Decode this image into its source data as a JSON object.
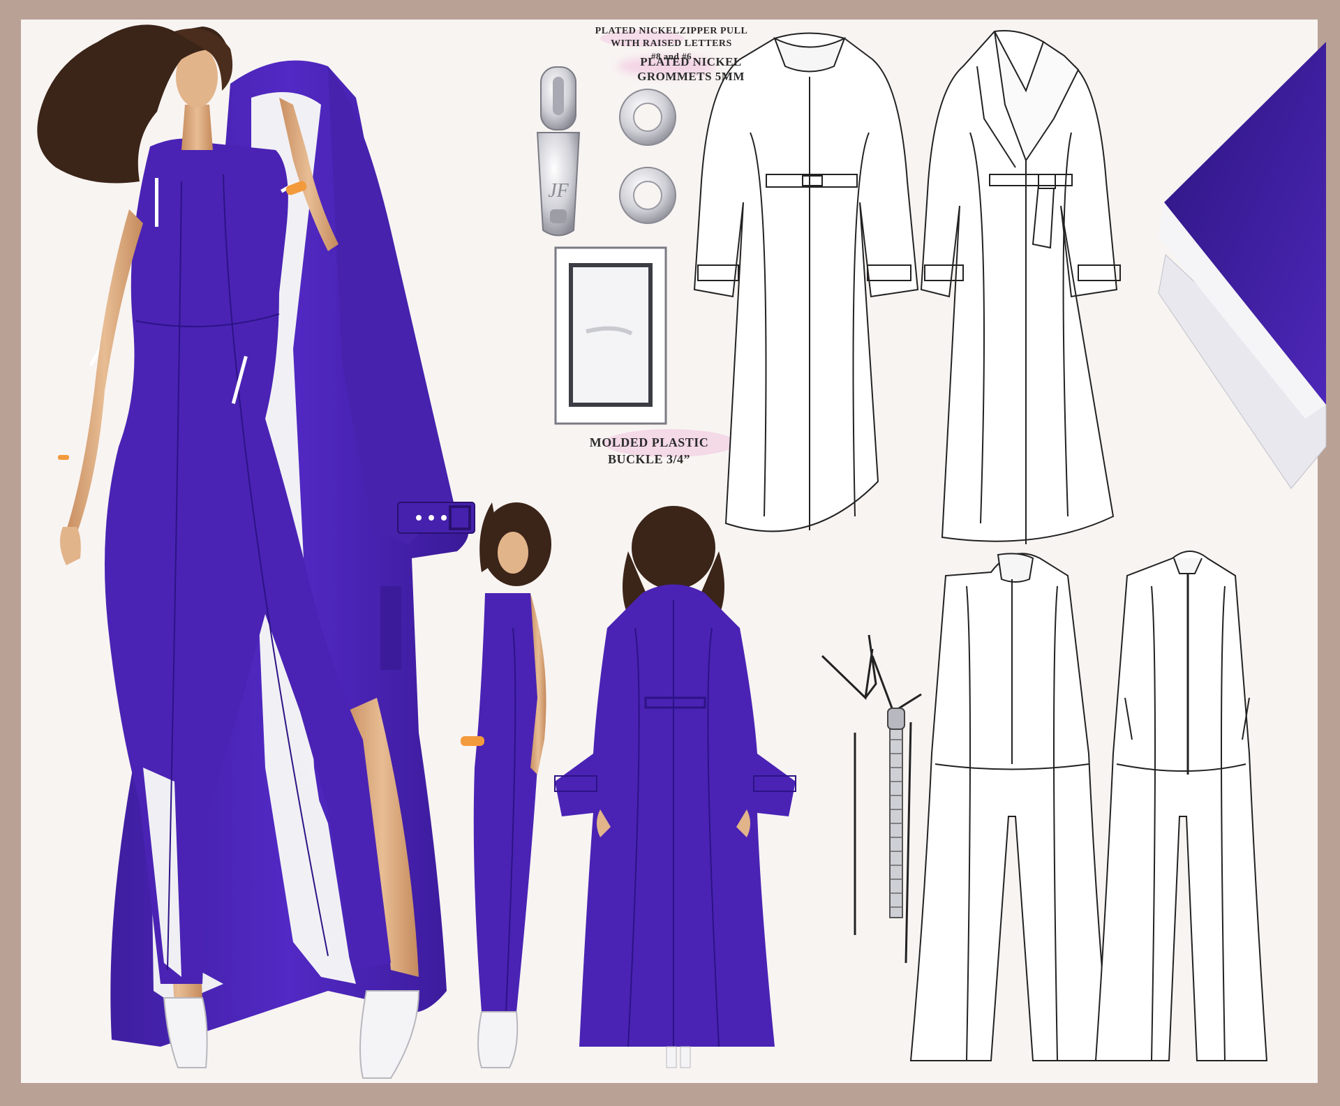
{
  "labels": {
    "zipper_pull": [
      "PLATED NICKELZIPPER PULL",
      "WITH RAISED LETTERS",
      "#8 and #6"
    ],
    "grommets": [
      "PLATED NICKEL",
      "GROMMETS 5MM"
    ],
    "buckle": [
      "MOLDED PLASTIC",
      "BUCKLE 3/4”"
    ]
  },
  "zipper_pull_monogram": "JF",
  "colors": {
    "frame": "#b9a196",
    "paper": "#f8f4f2",
    "garment_purple": "#4a23b4",
    "lining_white": "#f2f2f6",
    "skin": "#e2b48a",
    "hair": "#3b2418",
    "accent_orange": "#f39a3c",
    "nickel": "#c8c8ce"
  }
}
